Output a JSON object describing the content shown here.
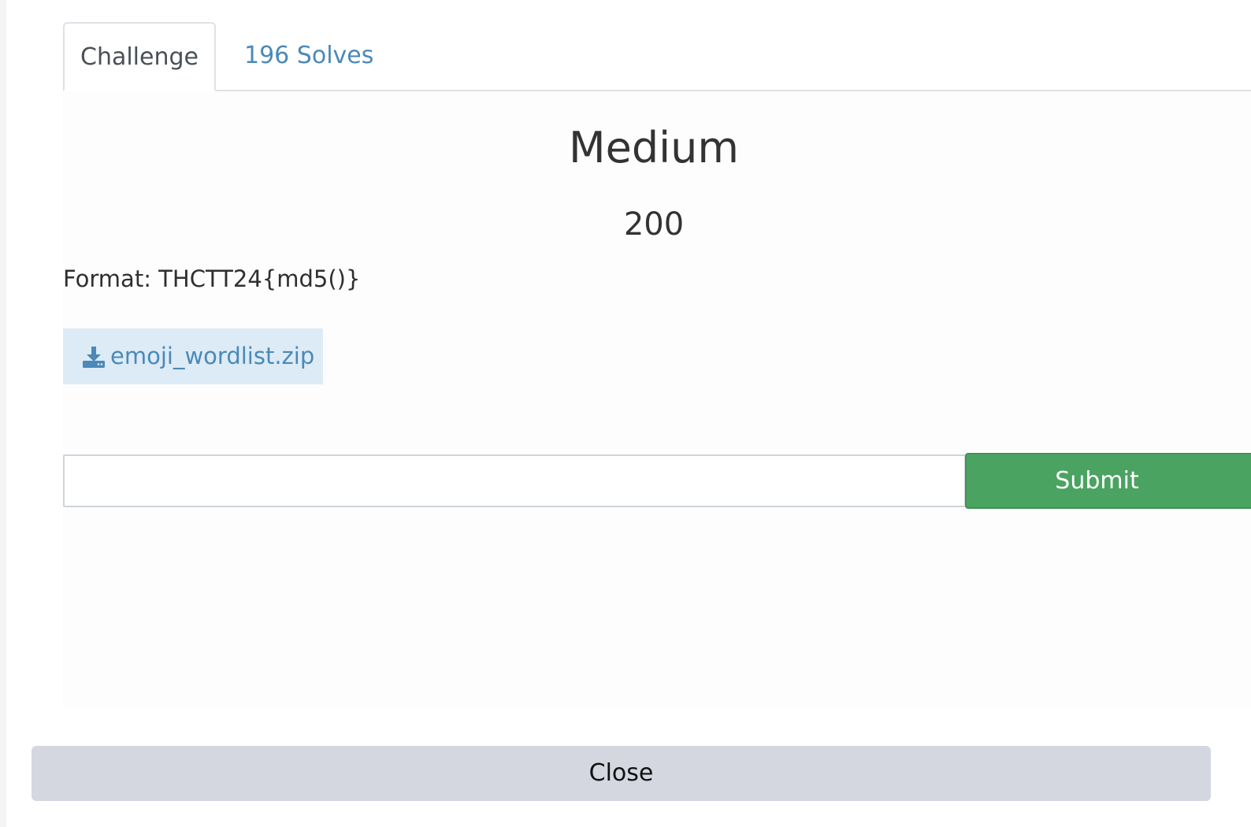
{
  "tabs": [
    {
      "label": "Challenge",
      "active": true
    },
    {
      "label": "196 Solves",
      "active": false
    }
  ],
  "challenge": {
    "name": "Medium",
    "value": "200",
    "description": "Format: THCTT24{md5()}"
  },
  "files": [
    {
      "name": "emoji_wordlist.zip",
      "icon": "download-icon"
    }
  ],
  "flag_form": {
    "input_value": "",
    "input_placeholder": "",
    "submit_label": "Submit"
  },
  "footer": {
    "close_label": "Close"
  },
  "colors": {
    "link": "#4a89b8",
    "submit": "#4aa360",
    "file_bg": "#ddebf6",
    "close_bg": "#d4d7df"
  }
}
